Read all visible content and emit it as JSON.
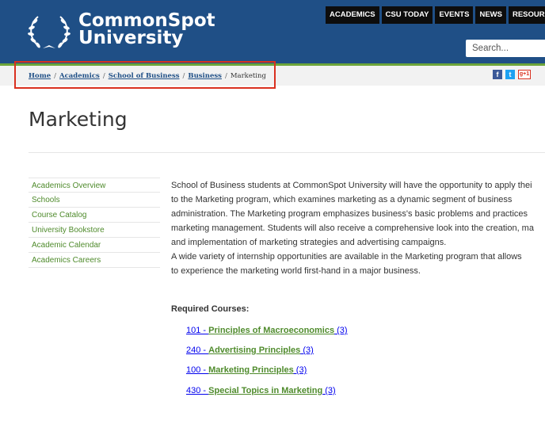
{
  "header": {
    "logo_line1": "CommonSpot",
    "logo_line2": "University",
    "nav": [
      "ACADEMICS",
      "CSU TODAY",
      "EVENTS",
      "NEWS",
      "RESOURCES"
    ],
    "search_placeholder": "Search..."
  },
  "breadcrumb": {
    "links": [
      "Home",
      "Academics",
      "School of Business",
      "Business"
    ],
    "current": "Marketing",
    "separator": "/"
  },
  "social": {
    "facebook": "f",
    "twitter": "t",
    "googleplus": "g+1"
  },
  "page": {
    "title": "Marketing"
  },
  "sidebar": {
    "items": [
      "Academics Overview",
      "Schools",
      "Course Catalog",
      "University Bookstore",
      "Academic Calendar",
      "Academics Careers"
    ]
  },
  "content": {
    "lines": [
      "School of Business students at CommonSpot University will have the opportunity to apply thei",
      "to the Marketing program, which examines marketing as a dynamic segment of business",
      "administration. The Marketing program emphasizes business's basic problems and practices",
      "marketing management. Students will also receive a comprehensive look into the creation, ma",
      "and implementation of marketing strategies and advertising campaigns.",
      "A wide variety of internship opportunities are available in the Marketing program that allows",
      "to experience the marketing world first-hand in a major business."
    ],
    "required_heading": "Required Courses:",
    "courses": [
      {
        "code": "101 - ",
        "name": "Principles of Macroeconomics",
        "credits": " (3)"
      },
      {
        "code": "240 - ",
        "name": "Advertising Principles",
        "credits": " (3)"
      },
      {
        "code": "100 - ",
        "name": "Marketing Principles",
        "credits": " (3)"
      },
      {
        "code": "430 - ",
        "name": "Special Topics in Marketing",
        "credits": " (3)"
      }
    ]
  },
  "colors": {
    "header_bg": "#1f4f86",
    "accent_green": "#6da53a",
    "highlight": "#d9301f"
  }
}
